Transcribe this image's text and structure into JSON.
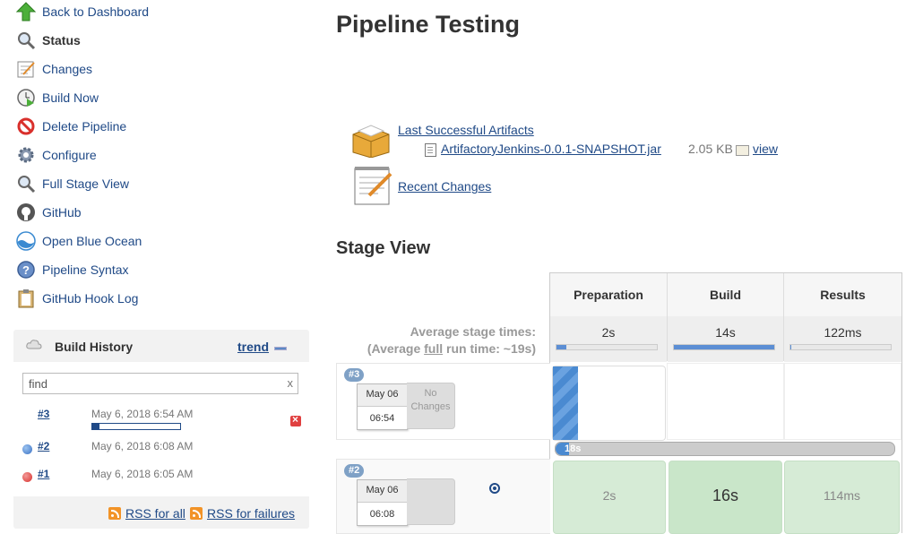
{
  "sidebar": {
    "tasks": [
      {
        "label": "Back to Dashboard",
        "icon": "up-arrow-icon"
      },
      {
        "label": "Status",
        "icon": "magnifier-icon",
        "active": true
      },
      {
        "label": "Changes",
        "icon": "notepad-icon"
      },
      {
        "label": "Build Now",
        "icon": "clock-play-icon"
      },
      {
        "label": "Delete Pipeline",
        "icon": "no-entry-icon"
      },
      {
        "label": "Configure",
        "icon": "gear-icon"
      },
      {
        "label": "Full Stage View",
        "icon": "magnifier-icon"
      },
      {
        "label": "GitHub",
        "icon": "github-icon"
      },
      {
        "label": "Open Blue Ocean",
        "icon": "blue-ocean-icon"
      },
      {
        "label": "Pipeline Syntax",
        "icon": "help-icon"
      },
      {
        "label": "GitHub Hook Log",
        "icon": "clipboard-icon"
      }
    ]
  },
  "build_history": {
    "title": "Build History",
    "trend_label": "trend",
    "find_value": "find",
    "clear_label": "x",
    "builds": [
      {
        "number": "#3",
        "date": "May 6, 2018 6:54 AM",
        "status": "running",
        "progress": 0.08
      },
      {
        "number": "#2",
        "date": "May 6, 2018 6:08 AM",
        "status": "success",
        "color": "#3a72c4"
      },
      {
        "number": "#1",
        "date": "May 6, 2018 6:05 AM",
        "status": "failed",
        "color": "#d9302c"
      }
    ],
    "rss_all": "RSS for all",
    "rss_failures": "RSS for failures"
  },
  "main": {
    "title": "Pipeline Testing",
    "artifacts_label": "Last Successful Artifacts",
    "artifact": {
      "name": "ArtifactoryJenkins-0.0.1-SNAPSHOT.jar",
      "size": "2.05 KB",
      "view_label": "view"
    },
    "recent_changes_label": "Recent Changes",
    "stage_view_title": "Stage View"
  },
  "stage_view": {
    "avg_label": "Average stage times:",
    "avg_full_prefix": "(Average ",
    "avg_full_word": "full",
    "avg_full_suffix": " run time: ~19s)",
    "stages": [
      {
        "name": "Preparation",
        "avg": "2s",
        "avg_fraction": 0.1
      },
      {
        "name": "Build",
        "avg": "14s",
        "avg_fraction": 1.0
      },
      {
        "name": "Results",
        "avg": "122ms",
        "avg_fraction": 0.01
      }
    ],
    "runs": [
      {
        "badge": "#3",
        "date": "May 06",
        "time": "06:54",
        "changes": "No Changes",
        "progress_label": "18s",
        "progress": 0.04
      },
      {
        "badge": "#2",
        "date": "May 06",
        "time": "06:08",
        "changes": "",
        "durations": [
          "2s",
          "16s",
          "114ms"
        ]
      }
    ]
  },
  "colors": {
    "link": "#204a87",
    "success_cell": "#d6ebd6",
    "running": "#4a8ad1"
  }
}
